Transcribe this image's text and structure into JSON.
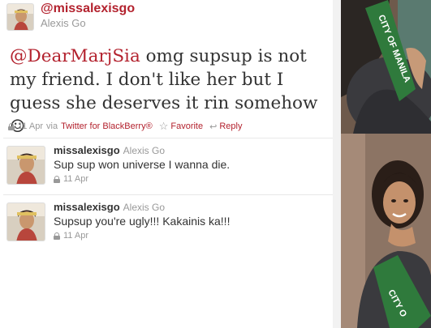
{
  "main_tweet": {
    "handle": "@missalexisgo",
    "name": "Alexis Go",
    "mention": "@DearMarjSia",
    "text": " omg supsup is not my friend. I don't like her but I guess she deserves it rin somehow ☺",
    "time": "11 Apr",
    "via": "via",
    "client": "Twitter for BlackBerry®",
    "favorite_label": "Favorite",
    "reply_label": "Reply"
  },
  "replies": [
    {
      "username": "missalexisgo",
      "name": "Alexis Go",
      "text": "Sup sup won universe I wanna die.",
      "time": "11 Apr"
    },
    {
      "username": "missalexisgo",
      "name": "Alexis Go",
      "text": "Supsup you're ugly!!! Kakainis ka!!!",
      "time": "11 Apr"
    }
  ],
  "colors": {
    "link": "#b3222e",
    "meta": "#999999",
    "text": "#333333",
    "sash": "#2f7a3c"
  },
  "photo": {
    "sash_text": "CITY OF MANILA",
    "sash_text_short": "CITY O"
  }
}
